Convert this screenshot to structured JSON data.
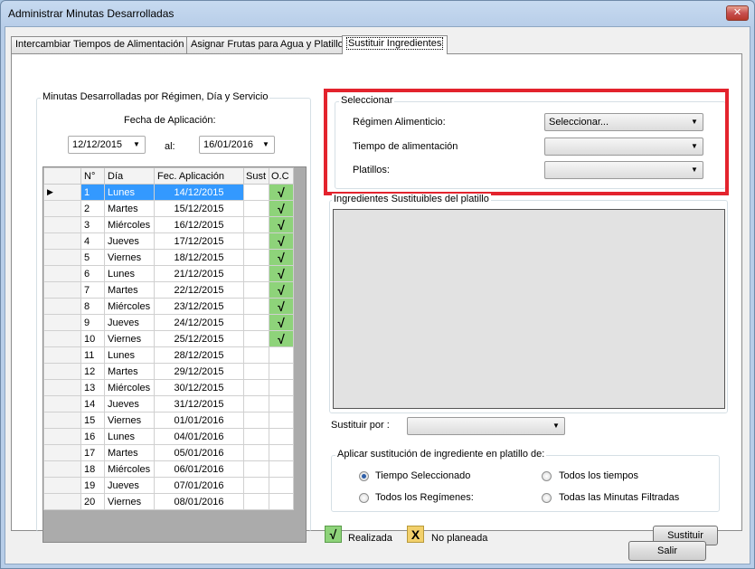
{
  "window": {
    "title": "Administrar Minutas Desarrolladas",
    "close_glyph": "✕"
  },
  "tabs": [
    {
      "label": "Intercambiar Tiempos de Alimentación"
    },
    {
      "label": "Asignar Frutas para Agua y Platillo"
    },
    {
      "label": "Sustituir Ingredientes"
    }
  ],
  "left": {
    "group_title": "Minutas Desarrolladas por Régimen, Día y Servicio",
    "fecha_label": "Fecha de Aplicación:",
    "from_date": "12/12/2015",
    "al_label": "al:",
    "to_date": "16/01/2016",
    "columns": [
      "N°",
      "Día",
      "Fec. Aplicación",
      "Sust",
      "O.C"
    ],
    "rows": [
      {
        "n": "1",
        "dia": "Lunes",
        "fecha": "14/12/2015",
        "oc": "√",
        "selected": true
      },
      {
        "n": "2",
        "dia": "Martes",
        "fecha": "15/12/2015",
        "oc": "√"
      },
      {
        "n": "3",
        "dia": "Miércoles",
        "fecha": "16/12/2015",
        "oc": "√"
      },
      {
        "n": "4",
        "dia": "Jueves",
        "fecha": "17/12/2015",
        "oc": "√"
      },
      {
        "n": "5",
        "dia": "Viernes",
        "fecha": "18/12/2015",
        "oc": "√"
      },
      {
        "n": "6",
        "dia": "Lunes",
        "fecha": "21/12/2015",
        "oc": "√"
      },
      {
        "n": "7",
        "dia": "Martes",
        "fecha": "22/12/2015",
        "oc": "√"
      },
      {
        "n": "8",
        "dia": "Miércoles",
        "fecha": "23/12/2015",
        "oc": "√"
      },
      {
        "n": "9",
        "dia": "Jueves",
        "fecha": "24/12/2015",
        "oc": "√"
      },
      {
        "n": "10",
        "dia": "Viernes",
        "fecha": "25/12/2015",
        "oc": "√"
      },
      {
        "n": "11",
        "dia": "Lunes",
        "fecha": "28/12/2015",
        "oc": ""
      },
      {
        "n": "12",
        "dia": "Martes",
        "fecha": "29/12/2015",
        "oc": ""
      },
      {
        "n": "13",
        "dia": "Miércoles",
        "fecha": "30/12/2015",
        "oc": ""
      },
      {
        "n": "14",
        "dia": "Jueves",
        "fecha": "31/12/2015",
        "oc": ""
      },
      {
        "n": "15",
        "dia": "Viernes",
        "fecha": "01/01/2016",
        "oc": ""
      },
      {
        "n": "16",
        "dia": "Lunes",
        "fecha": "04/01/2016",
        "oc": ""
      },
      {
        "n": "17",
        "dia": "Martes",
        "fecha": "05/01/2016",
        "oc": ""
      },
      {
        "n": "18",
        "dia": "Miércoles",
        "fecha": "06/01/2016",
        "oc": ""
      },
      {
        "n": "19",
        "dia": "Jueves",
        "fecha": "07/01/2016",
        "oc": ""
      },
      {
        "n": "20",
        "dia": "Viernes",
        "fecha": "08/01/2016",
        "oc": ""
      }
    ],
    "row_pointer": "▶"
  },
  "seleccionar": {
    "title": "Seleccionar",
    "regimen_label": "Régimen Alimenticio:",
    "regimen_value": "Seleccionar...",
    "tiempo_label": "Tiempo de alimentación",
    "tiempo_value": "",
    "platillos_label": "Platillos:",
    "platillos_value": ""
  },
  "ingredientes": {
    "title": "Ingredientes Sustituibles del platillo"
  },
  "sustituir_por": {
    "label": "Sustituir por :",
    "value": ""
  },
  "aplicar": {
    "title": "Aplicar sustitución de ingrediente en platillo de:",
    "options": [
      {
        "label": "Tiempo Seleccionado",
        "checked": true
      },
      {
        "label": "Todos los tiempos",
        "checked": false
      },
      {
        "label": "Todos los Regímenes:",
        "checked": false
      },
      {
        "label": "Todas las Minutas Filtradas",
        "checked": false
      }
    ]
  },
  "legend": {
    "realizada_symbol": "√",
    "realizada_label": "Realizada",
    "no_planeada_symbol": "X",
    "no_planeada_label": "No planeada"
  },
  "buttons": {
    "sustituir": "Sustituir",
    "salir": "Salir"
  },
  "colors": {
    "selected_row": "#3399ff",
    "check_green": "#8ed37a",
    "no_planeada": "#f2d06b",
    "highlight_red": "#e3232d"
  }
}
